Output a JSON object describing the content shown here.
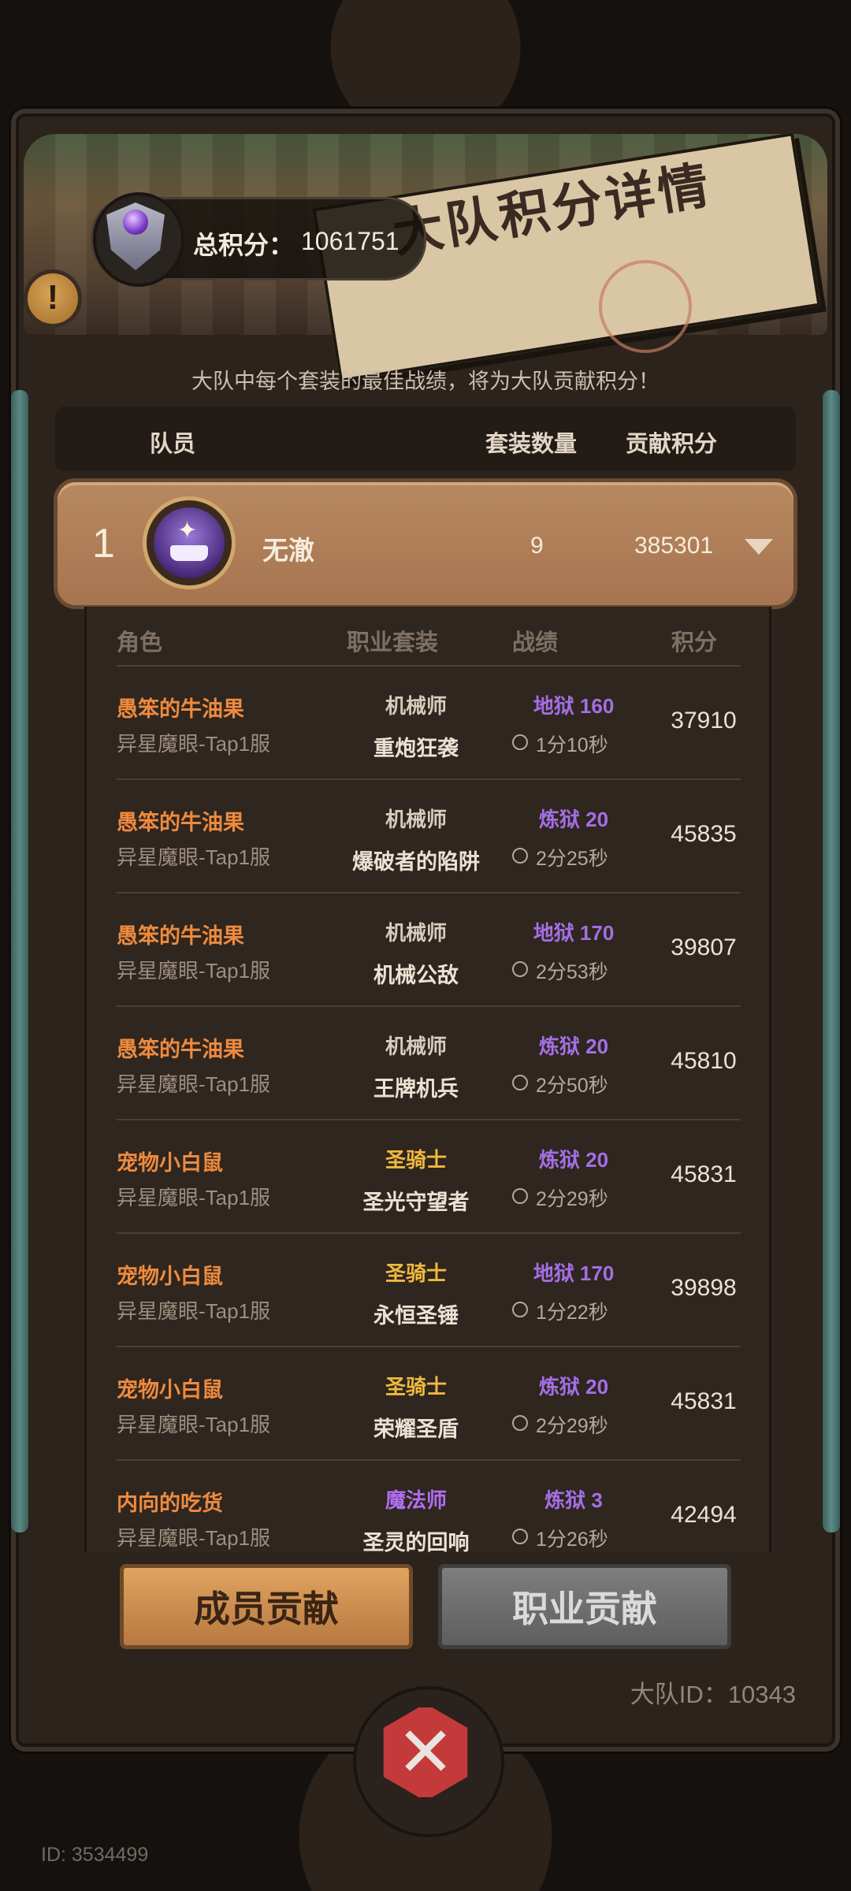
{
  "header": {
    "title": "大队积分详情",
    "total_label": "总积分：",
    "total_value": "1061751",
    "info_icon": "!"
  },
  "note": "大队中每个套装的最佳战绩，将为大队贡献积分！",
  "columns": {
    "member": "队员",
    "set_count": "套装数量",
    "contribution": "贡献积分"
  },
  "member": {
    "rank": "1",
    "name": "无澈",
    "set_count": "9",
    "points": "385301"
  },
  "detail_columns": {
    "role": "角色",
    "class_set": "职业套装",
    "record": "战绩",
    "score": "积分"
  },
  "rows": [
    {
      "role": "愚笨的牛油果",
      "server": "异星魔眼-Tap1服",
      "class": "机械师",
      "class_color": "#d8ccbc",
      "set": "重炮狂袭",
      "mode": "地狱 160",
      "time": "1分10秒",
      "score": "37910"
    },
    {
      "role": "愚笨的牛油果",
      "server": "异星魔眼-Tap1服",
      "class": "机械师",
      "class_color": "#d8ccbc",
      "set": "爆破者的陷阱",
      "mode": "炼狱 20",
      "time": "2分25秒",
      "score": "45835"
    },
    {
      "role": "愚笨的牛油果",
      "server": "异星魔眼-Tap1服",
      "class": "机械师",
      "class_color": "#d8ccbc",
      "set": "机械公敌",
      "mode": "地狱 170",
      "time": "2分53秒",
      "score": "39807"
    },
    {
      "role": "愚笨的牛油果",
      "server": "异星魔眼-Tap1服",
      "class": "机械师",
      "class_color": "#d8ccbc",
      "set": "王牌机兵",
      "mode": "炼狱 20",
      "time": "2分50秒",
      "score": "45810"
    },
    {
      "role": "宠物小白鼠",
      "server": "异星魔眼-Tap1服",
      "class": "圣骑士",
      "class_color": "#f0b93c",
      "set": "圣光守望者",
      "mode": "炼狱 20",
      "time": "2分29秒",
      "score": "45831"
    },
    {
      "role": "宠物小白鼠",
      "server": "异星魔眼-Tap1服",
      "class": "圣骑士",
      "class_color": "#f0b93c",
      "set": "永恒圣锤",
      "mode": "地狱 170",
      "time": "1分22秒",
      "score": "39898"
    },
    {
      "role": "宠物小白鼠",
      "server": "异星魔眼-Tap1服",
      "class": "圣骑士",
      "class_color": "#f0b93c",
      "set": "荣耀圣盾",
      "mode": "炼狱 20",
      "time": "2分29秒",
      "score": "45831"
    },
    {
      "role": "内向的吃货",
      "server": "异星魔眼-Tap1服",
      "class": "魔法师",
      "class_color": "#b06ef0",
      "set": "圣灵的回响",
      "mode": "炼狱 3",
      "time": "1分26秒",
      "score": "42494"
    }
  ],
  "buttons": {
    "member": "成员贡献",
    "class": "职业贡献"
  },
  "team_id": "大队ID：10343",
  "bottom_id": "ID: 3534499"
}
